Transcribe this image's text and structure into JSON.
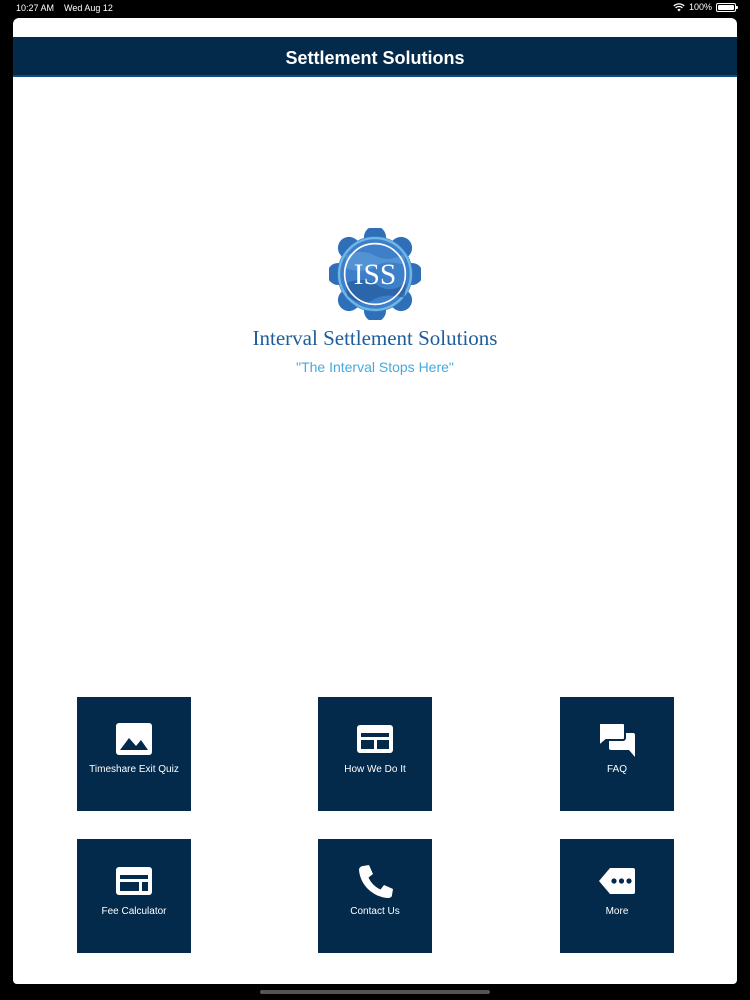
{
  "status_bar": {
    "time": "10:27 AM",
    "date": "Wed Aug 12",
    "battery": "100%"
  },
  "navbar": {
    "title": "Settlement Solutions"
  },
  "logo": {
    "monogram": "ISS",
    "company_name": "Interval Settlement Solutions",
    "tagline": "\"The Interval Stops Here\""
  },
  "tiles": [
    {
      "label": "Timeshare Exit Quiz",
      "icon": "image-icon"
    },
    {
      "label": "How We Do It",
      "icon": "layout-icon"
    },
    {
      "label": "FAQ",
      "icon": "chat-bubbles-icon"
    },
    {
      "label": "Fee Calculator",
      "icon": "layout-icon"
    },
    {
      "label": "Contact Us",
      "icon": "phone-icon"
    },
    {
      "label": "More",
      "icon": "more-tag-icon"
    }
  ],
  "colors": {
    "brand_navy": "#032a4b",
    "brand_blue": "#1e5d9a",
    "accent_light_blue": "#48a9dc"
  }
}
